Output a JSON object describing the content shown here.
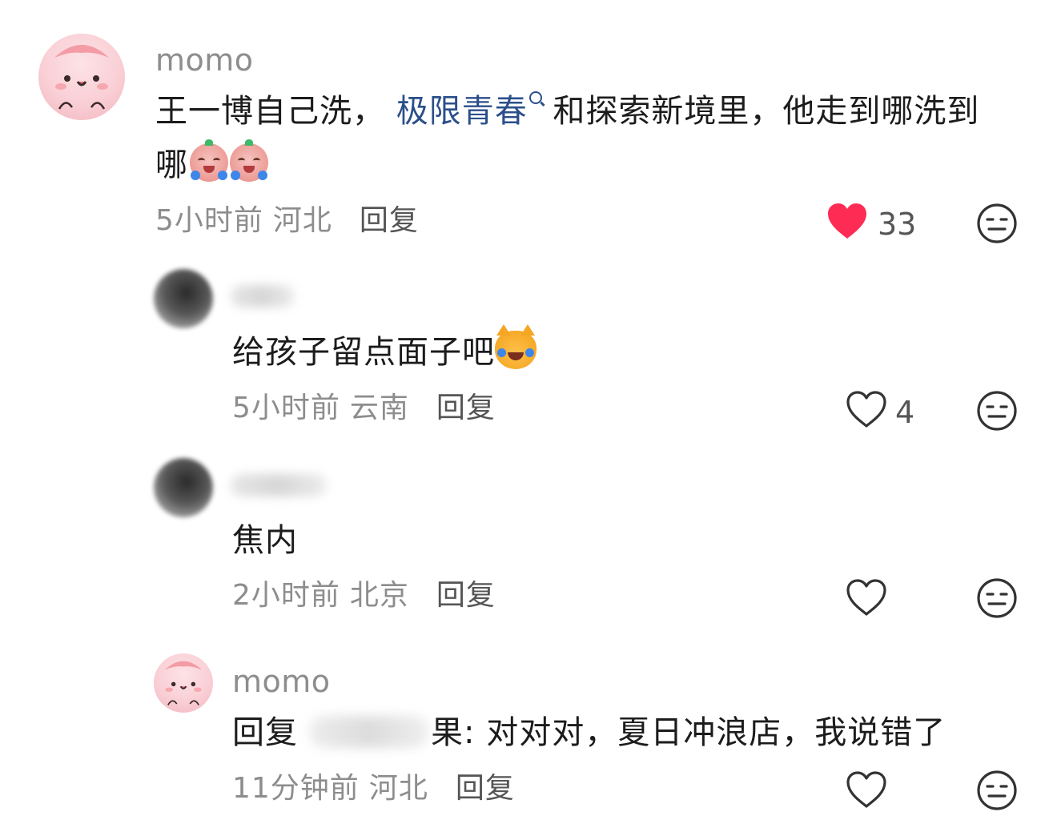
{
  "comments": [
    {
      "username": "momo",
      "text_before_link": "王一博自己洗， ",
      "link_text": "极限青春",
      "text_after_link": " 和探索新境里，他走到哪洗到",
      "text_line2": "哪",
      "time": "5小时前",
      "location": "河北",
      "reply_label": "回复",
      "like_count": "33",
      "liked": true
    },
    {
      "username": "",
      "text": "给孩子留点面子吧",
      "time": "5小时前",
      "location": "云南",
      "reply_label": "回复",
      "like_count": "4",
      "liked": false
    },
    {
      "username": "",
      "text": "焦内",
      "time": "2小时前",
      "location": "北京",
      "reply_label": "回复",
      "like_count": "",
      "liked": false
    },
    {
      "username": "momo",
      "reply_prefix": "回复",
      "reply_target_tail": "果",
      "text": ": 对对对，夏日冲浪店，我说错了",
      "time": "11分钟前",
      "location": "河北",
      "reply_label": "回复",
      "like_count": "",
      "liked": false
    }
  ],
  "colors": {
    "like_active": "#fe2c55",
    "link": "#2b4f8a",
    "muted_text": "#8d8d8d"
  },
  "icons": [
    "heart-icon",
    "dislike-face-icon",
    "search-icon"
  ]
}
